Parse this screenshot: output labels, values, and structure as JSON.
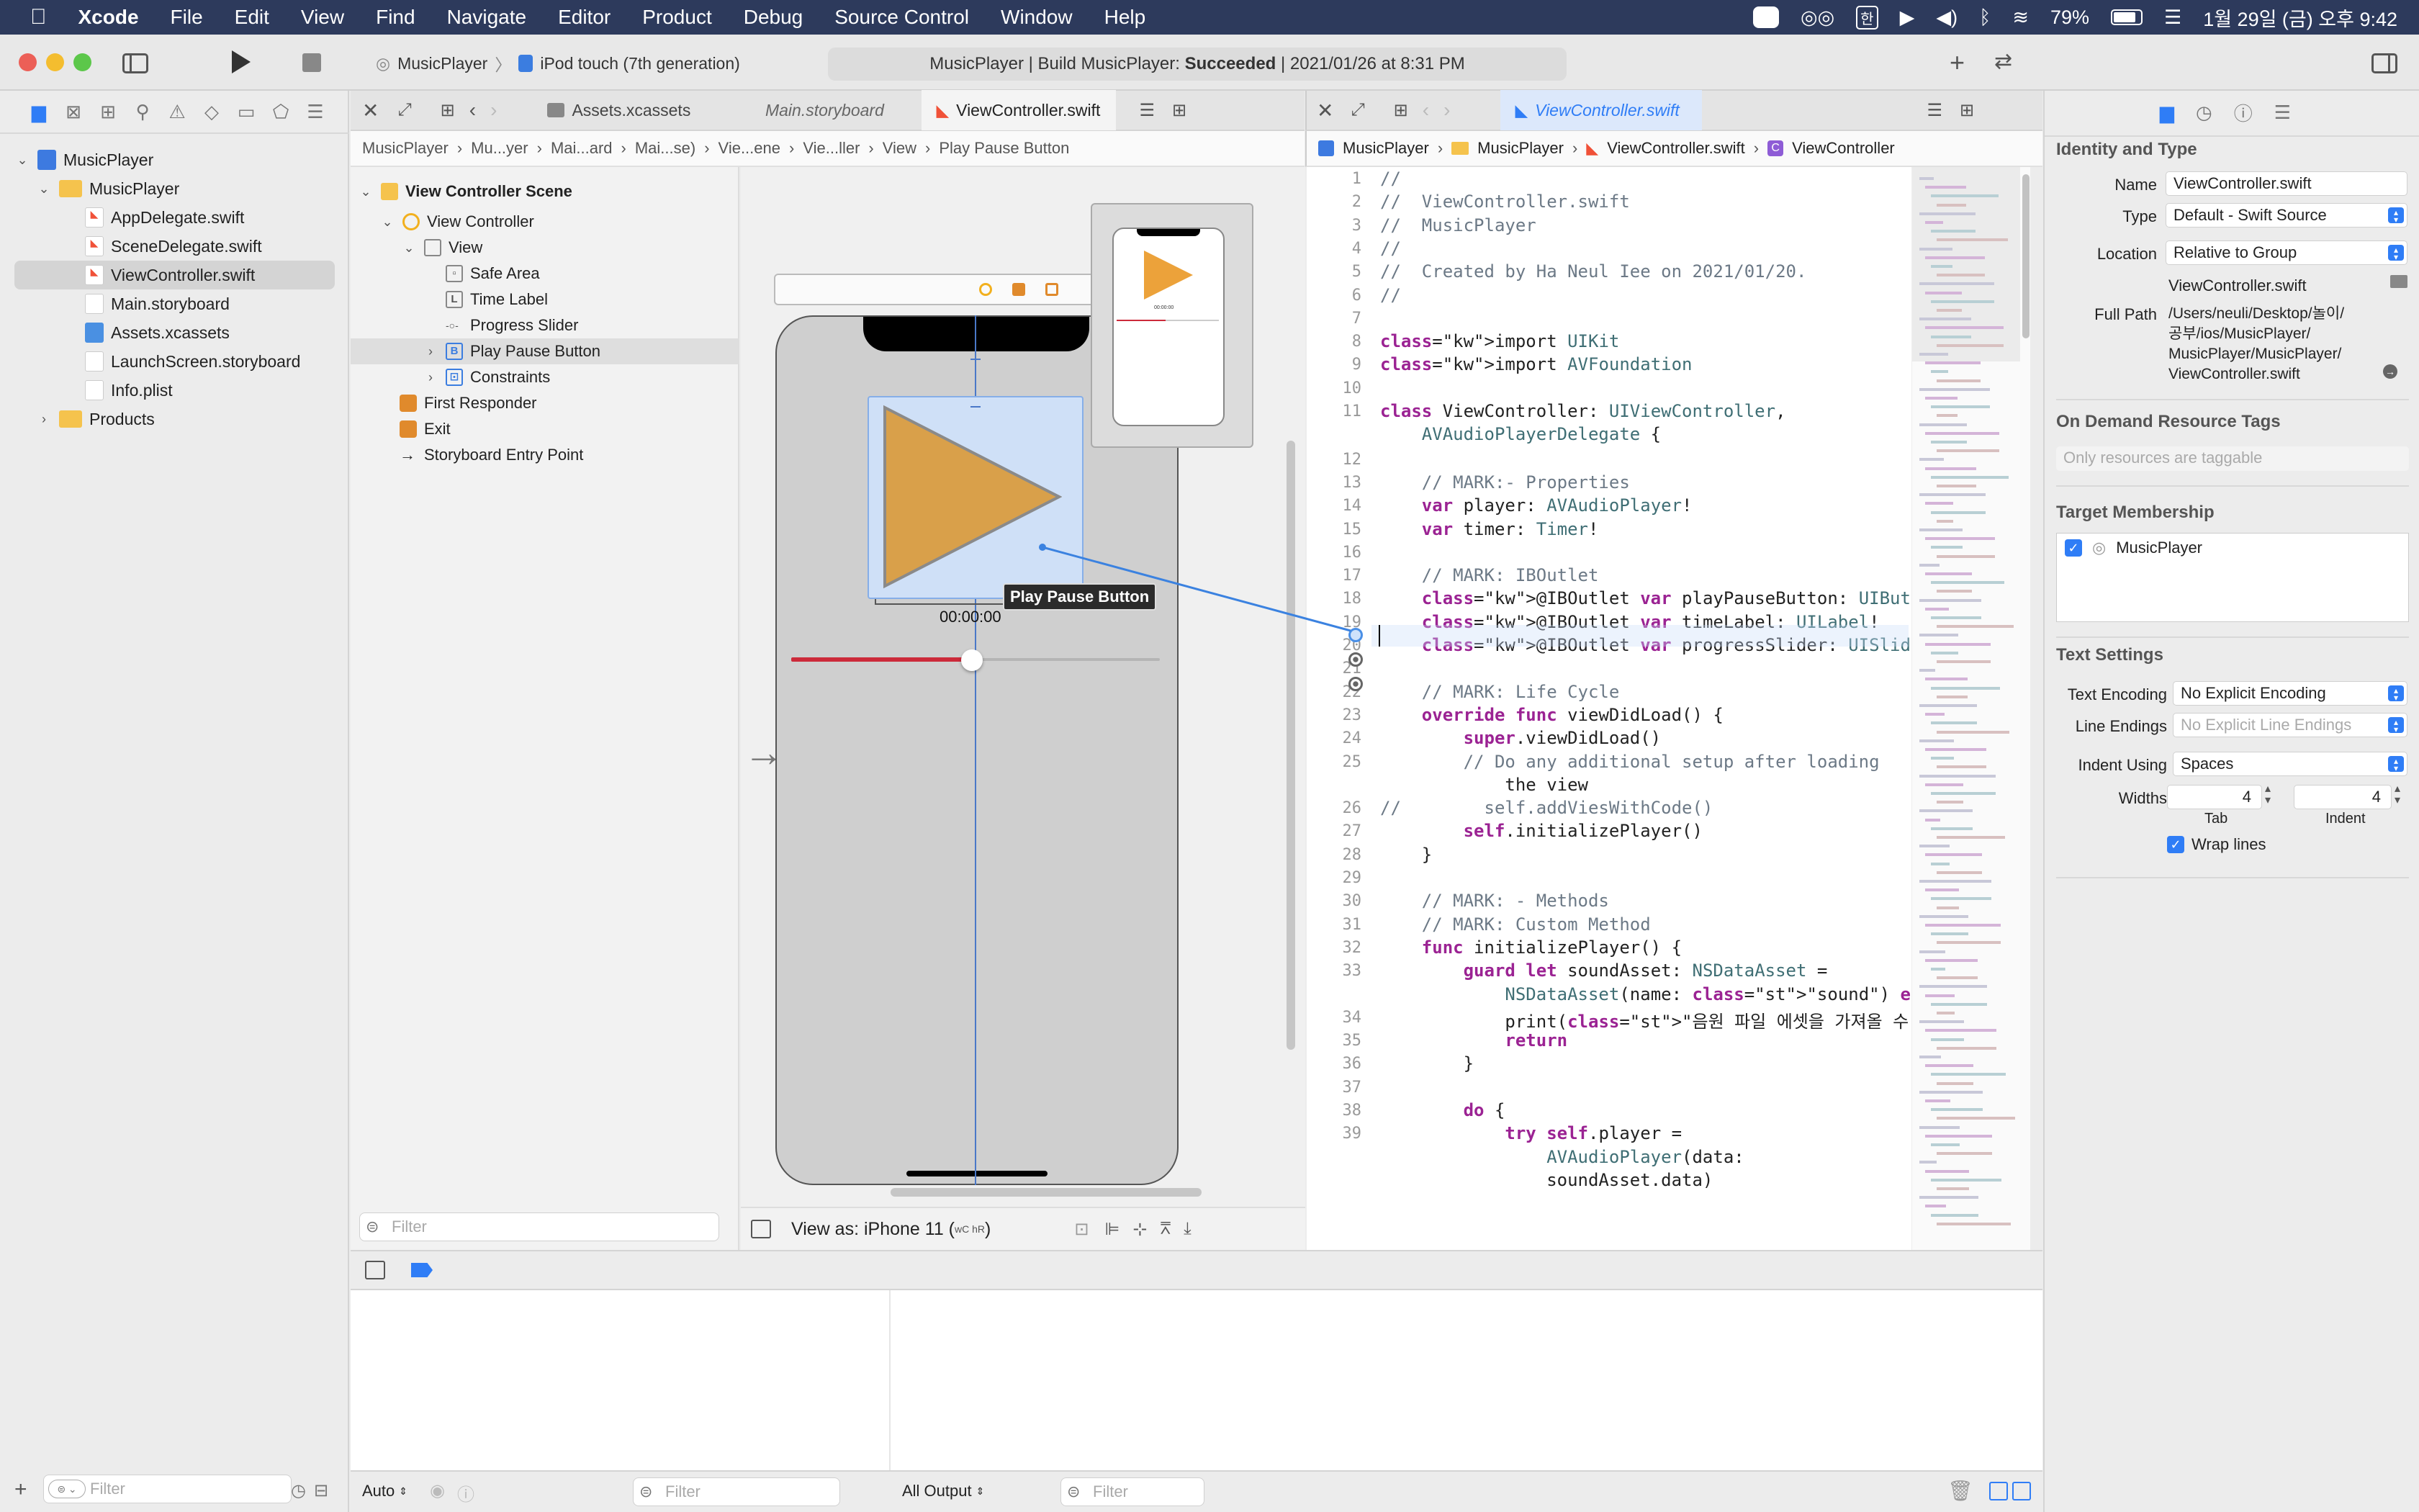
{
  "menubar": {
    "apple": "",
    "app": "Xcode",
    "items": [
      "File",
      "Edit",
      "View",
      "Find",
      "Navigate",
      "Editor",
      "Product",
      "Debug",
      "Source Control",
      "Window",
      "Help"
    ],
    "battery": "79%",
    "datetime": "1월 29일 (금) 오후 9:42"
  },
  "toolbar": {
    "scheme": "MusicPlayer",
    "device": "iPod touch (7th generation)",
    "status_prefix": "MusicPlayer | Build MusicPlayer: ",
    "status_result": "Succeeded",
    "status_suffix": " | 2021/01/26 at 8:31 PM"
  },
  "navigator": {
    "items": [
      {
        "label": "MusicPlayer",
        "kind": "project"
      },
      {
        "label": "MusicPlayer",
        "kind": "folder"
      },
      {
        "label": "AppDelegate.swift",
        "kind": "swift"
      },
      {
        "label": "SceneDelegate.swift",
        "kind": "swift"
      },
      {
        "label": "ViewController.swift",
        "kind": "swift"
      },
      {
        "label": "Main.storyboard",
        "kind": "storyboard"
      },
      {
        "label": "Assets.xcassets",
        "kind": "assets"
      },
      {
        "label": "LaunchScreen.storyboard",
        "kind": "storyboard"
      },
      {
        "label": "Info.plist",
        "kind": "plist"
      },
      {
        "label": "Products",
        "kind": "folder"
      }
    ],
    "filter_placeholder": "Filter"
  },
  "left_editor": {
    "tabs": [
      "Assets.xcassets",
      "Main.storyboard",
      "ViewController.swift"
    ],
    "jumpbar": [
      "MusicPlayer",
      "Mu...yer",
      "Mai...ard",
      "Mai...se)",
      "Vie...ene",
      "Vie...ller",
      "View",
      "Play Pause Button"
    ],
    "outline": {
      "scene": "View Controller Scene",
      "controller": "View Controller",
      "view": "View",
      "safe_area": "Safe Area",
      "time_label": "Time Label",
      "progress_slider": "Progress Slider",
      "play_button": "Play Pause Button",
      "constraints": "Constraints",
      "first_responder": "First Responder",
      "exit": "Exit",
      "entry_point": "Storyboard Entry Point",
      "filter_placeholder": "Filter"
    },
    "canvas": {
      "time_text": "00:00:00",
      "tooltip": "Play Pause Button",
      "view_as": "View as: iPhone 11 (",
      "view_as_traits": "wC hR",
      "view_as_end": ")",
      "thumb_time": "00:00:00"
    }
  },
  "right_editor": {
    "tab": "ViewController.swift",
    "jumpbar": [
      "MusicPlayer",
      "MusicPlayer",
      "ViewController.swift",
      "ViewController"
    ],
    "code": [
      {
        "n": "1",
        "t": "//"
      },
      {
        "n": "2",
        "t": "//  ViewController.swift"
      },
      {
        "n": "3",
        "t": "//  MusicPlayer"
      },
      {
        "n": "4",
        "t": "//"
      },
      {
        "n": "5",
        "t": "//  Created by Ha Neul Iee on 2021/01/20."
      },
      {
        "n": "6",
        "t": "//"
      },
      {
        "n": "7",
        "t": ""
      },
      {
        "n": "8",
        "t": "import UIKit"
      },
      {
        "n": "9",
        "t": "import AVFoundation"
      },
      {
        "n": "10",
        "t": ""
      },
      {
        "n": "11",
        "t": "class ViewController: UIViewController,"
      },
      {
        "n": "",
        "t": "    AVAudioPlayerDelegate {"
      },
      {
        "n": "12",
        "t": ""
      },
      {
        "n": "13",
        "t": "    // MARK:- Properties"
      },
      {
        "n": "14",
        "t": "    var player: AVAudioPlayer!"
      },
      {
        "n": "15",
        "t": "    var timer: Timer!"
      },
      {
        "n": "16",
        "t": ""
      },
      {
        "n": "17",
        "t": "    // MARK: IBOutlet"
      },
      {
        "n": "18",
        "t": "    @IBOutlet var playPauseButton: UIButton!"
      },
      {
        "n": "19",
        "t": "    @IBOutlet var timeLabel: UILabel!"
      },
      {
        "n": "20",
        "t": "    @IBOutlet var progressSlider: UISlider!"
      },
      {
        "n": "21",
        "t": ""
      },
      {
        "n": "22",
        "t": "    // MARK: Life Cycle"
      },
      {
        "n": "23",
        "t": "    override func viewDidLoad() {"
      },
      {
        "n": "24",
        "t": "        super.viewDidLoad()"
      },
      {
        "n": "25",
        "t": "        // Do any additional setup after loading"
      },
      {
        "n": "",
        "t": "            the view"
      },
      {
        "n": "26",
        "t": "//        self.addViesWithCode()"
      },
      {
        "n": "27",
        "t": "        self.initializePlayer()"
      },
      {
        "n": "28",
        "t": "    }"
      },
      {
        "n": "29",
        "t": ""
      },
      {
        "n": "30",
        "t": "    // MARK: - Methods"
      },
      {
        "n": "31",
        "t": "    // MARK: Custom Method"
      },
      {
        "n": "32",
        "t": "    func initializePlayer() {"
      },
      {
        "n": "33",
        "t": "        guard let soundAsset: NSDataAsset ="
      },
      {
        "n": "",
        "t": "            NSDataAsset(name: \"sound\") else {"
      },
      {
        "n": "34",
        "t": "            print(\"음원 파일 에셋을 가져올 수 없습니다\")"
      },
      {
        "n": "35",
        "t": "            return"
      },
      {
        "n": "36",
        "t": "        }"
      },
      {
        "n": "37",
        "t": ""
      },
      {
        "n": "38",
        "t": "        do {"
      },
      {
        "n": "39",
        "t": "            try self.player ="
      },
      {
        "n": "",
        "t": "                AVAudioPlayer(data:"
      },
      {
        "n": "",
        "t": "                soundAsset.data)"
      }
    ]
  },
  "inspector": {
    "identity_title": "Identity and Type",
    "name_label": "Name",
    "name_value": "ViewController.swift",
    "type_label": "Type",
    "type_value": "Default - Swift Source",
    "location_label": "Location",
    "location_value": "Relative to Group",
    "location_file": "ViewController.swift",
    "fullpath_label": "Full Path",
    "fullpath_lines": [
      "/Users/neuli/Desktop/놀이/",
      "공부/ios/MusicPlayer/",
      "MusicPlayer/MusicPlayer/",
      "ViewController.swift"
    ],
    "odr_title": "On Demand Resource Tags",
    "odr_placeholder": "Only resources are taggable",
    "target_title": "Target Membership",
    "target_name": "MusicPlayer",
    "text_title": "Text Settings",
    "encoding_label": "Text Encoding",
    "encoding_value": "No Explicit Encoding",
    "line_endings_label": "Line Endings",
    "line_endings_value": "No Explicit Line Endings",
    "indent_using_label": "Indent Using",
    "indent_using_value": "Spaces",
    "widths_label": "Widths",
    "tab_width": "4",
    "indent_width": "4",
    "tab_caption": "Tab",
    "indent_caption": "Indent",
    "wrap_label": "Wrap lines"
  },
  "debug": {
    "auto_label": "Auto",
    "filter_placeholder": "Filter",
    "output_select": "All Output",
    "filter2_placeholder": "Filter"
  },
  "colors": {
    "accent": "#2f7df6",
    "menubar": "#2d3a5c",
    "play": "#d9a04a",
    "slider": "#cc2a3a"
  }
}
